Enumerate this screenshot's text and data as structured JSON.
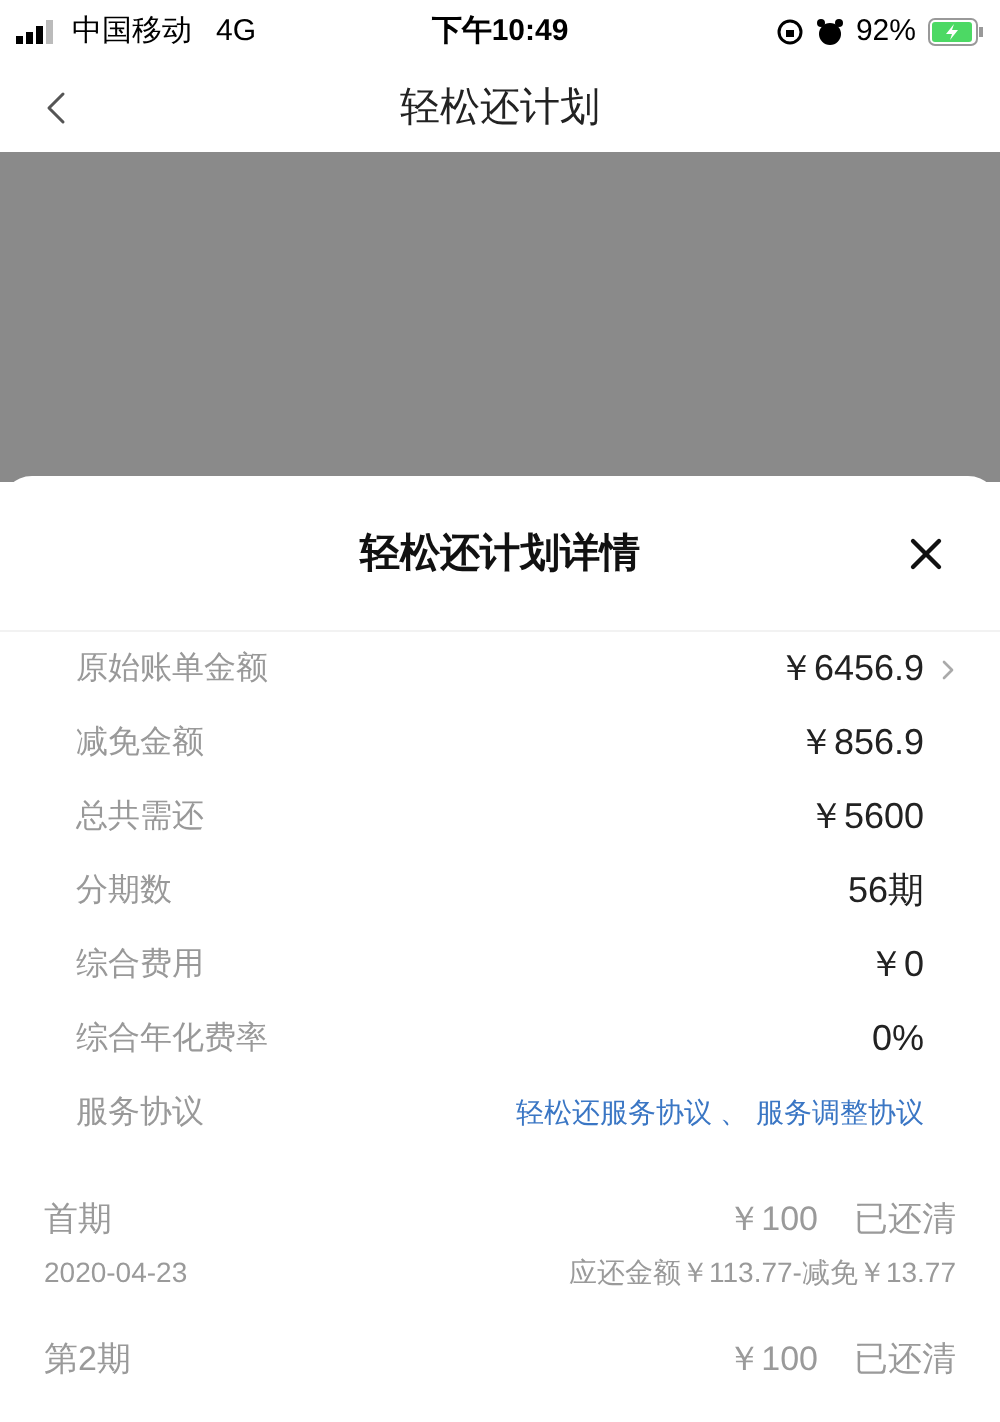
{
  "status_bar": {
    "carrier": "中国移动",
    "network": "4G",
    "time": "下午10:49",
    "battery": "92%"
  },
  "nav": {
    "title": "轻松还计划"
  },
  "sheet": {
    "title": "轻松还计划详情",
    "details": [
      {
        "kind": "amount",
        "label": "原始账单金额",
        "value": "￥6456.9",
        "chevron": true
      },
      {
        "kind": "amount",
        "label": "减免金额",
        "value": "￥856.9",
        "chevron": false
      },
      {
        "kind": "amount",
        "label": "总共需还",
        "value": "￥5600",
        "chevron": false
      },
      {
        "kind": "amount",
        "label": "分期数",
        "value": "56期",
        "chevron": false
      },
      {
        "kind": "amount",
        "label": "综合费用",
        "value": "￥0",
        "chevron": false
      },
      {
        "kind": "amount",
        "label": "综合年化费率",
        "value": "0%",
        "chevron": false
      },
      {
        "kind": "links",
        "label": "服务协议",
        "links": [
          "轻松还服务协议",
          "服务调整协议"
        ],
        "separator": "、"
      }
    ],
    "installments": [
      {
        "label": "首期",
        "amount": "￥100",
        "status": "已还清",
        "date": "2020-04-23",
        "detail": "应还金额￥113.77-减免￥13.77"
      },
      {
        "label": "第2期",
        "amount": "￥100",
        "status": "已还清"
      }
    ]
  }
}
